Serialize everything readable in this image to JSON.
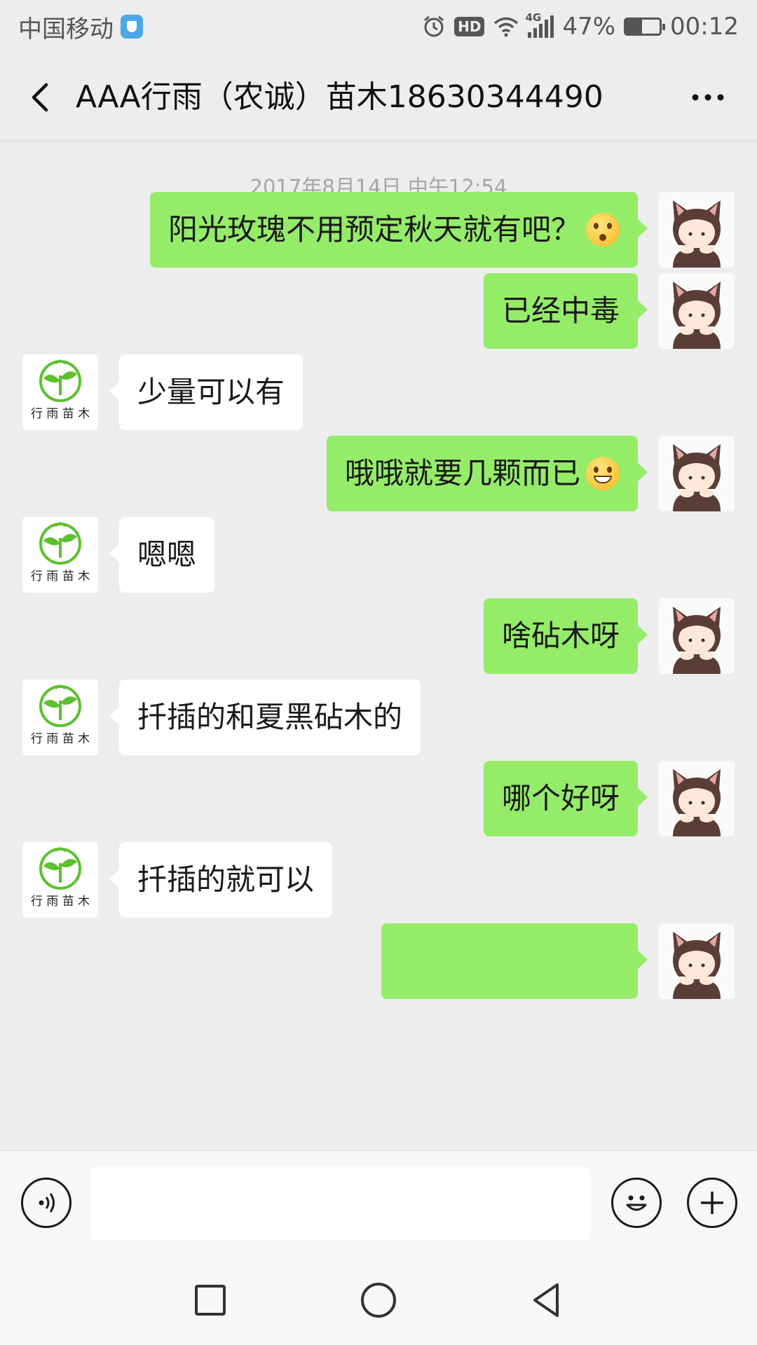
{
  "status_bar": {
    "carrier": "中国移动",
    "network": "4G",
    "hd": "HD",
    "battery_level": 47,
    "battery_text": "47%",
    "time": "00:12"
  },
  "header": {
    "title": "AAA行雨（农诚）苗木18630344490",
    "back_icon": "chevron-left-icon",
    "more_icon": "more-dots-icon"
  },
  "chat": {
    "timestamp": "2017年8月14日 中午12:54",
    "messages": [
      {
        "side": "right",
        "text": "阳光玫瑰不用预定秋天就有吧？",
        "emoji": "wow"
      },
      {
        "side": "right",
        "text": "已经中毒",
        "emoji": null
      },
      {
        "side": "left",
        "text": "少量可以有",
        "emoji": null
      },
      {
        "side": "right",
        "text": "哦哦就要几颗而已",
        "emoji": "grin"
      },
      {
        "side": "left",
        "text": "嗯嗯",
        "emoji": null
      },
      {
        "side": "right",
        "text": "啥砧木呀",
        "emoji": null
      },
      {
        "side": "left",
        "text": "扦插的和夏黑砧木的",
        "emoji": null
      },
      {
        "side": "right",
        "text": "哪个好呀",
        "emoji": null
      },
      {
        "side": "left",
        "text": "扦插的就可以",
        "emoji": null
      }
    ],
    "contact_avatar_caption": "行雨苗木",
    "colors": {
      "sent_bubble": "#95ec69",
      "received_bubble": "#ffffff",
      "background": "#ededed"
    }
  },
  "input_bar": {
    "voice_icon": "voice-icon",
    "emoji_icon": "smile-icon",
    "plus_icon": "plus-icon",
    "placeholder": ""
  },
  "nav_bar": {
    "recent_icon": "square-icon",
    "home_icon": "circle-icon",
    "back_icon": "triangle-back-icon"
  }
}
